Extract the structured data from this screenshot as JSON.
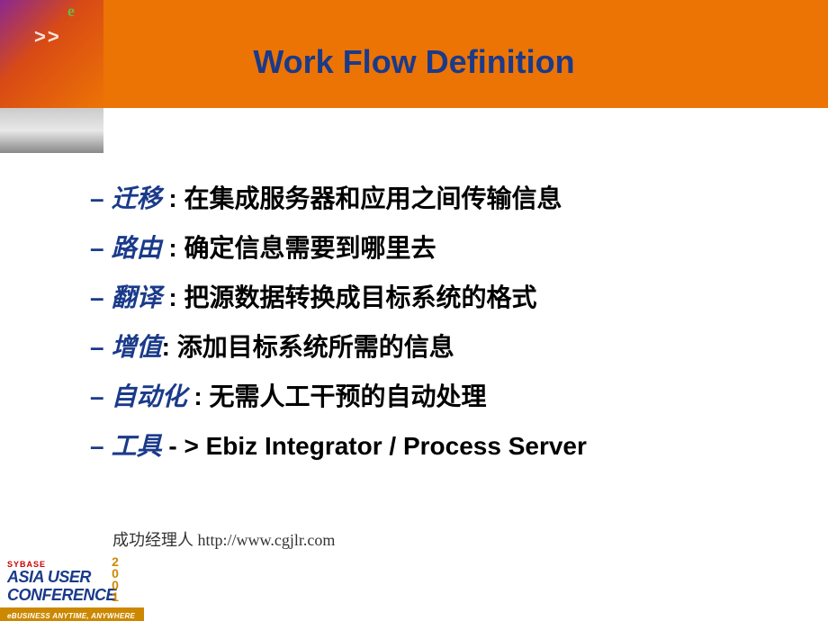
{
  "header": {
    "decor_e": "e",
    "decor_arrows": ">>",
    "title": "Work Flow Definition"
  },
  "bullets": [
    {
      "term": "迁移",
      "sep": " : ",
      "desc": "在集成服务器和应用之间传输信息"
    },
    {
      "term": "路由",
      "sep": " : ",
      "desc": "确定信息需要到哪里去"
    },
    {
      "term": "翻译",
      "sep": " : ",
      "desc": "把源数据转换成目标系统的格式"
    },
    {
      "term": "增值",
      "sep": ": ",
      "desc": "添加目标系统所需的信息"
    },
    {
      "term": "自动化",
      "sep": " : ",
      "desc": "无需人工干预的自动处理"
    },
    {
      "term": "工具",
      "sep": " - > ",
      "desc": "Ebiz Integrator / Process Server"
    }
  ],
  "footer": {
    "credit": "成功经理人 http://www.cgjlr.com",
    "logo": {
      "brand": "SYBASE",
      "line1": "ASIA USER",
      "line2": "CONFERENCE",
      "year": "2001",
      "tagline": "eBUSINESS ANYTIME, ANYWHERE"
    }
  }
}
